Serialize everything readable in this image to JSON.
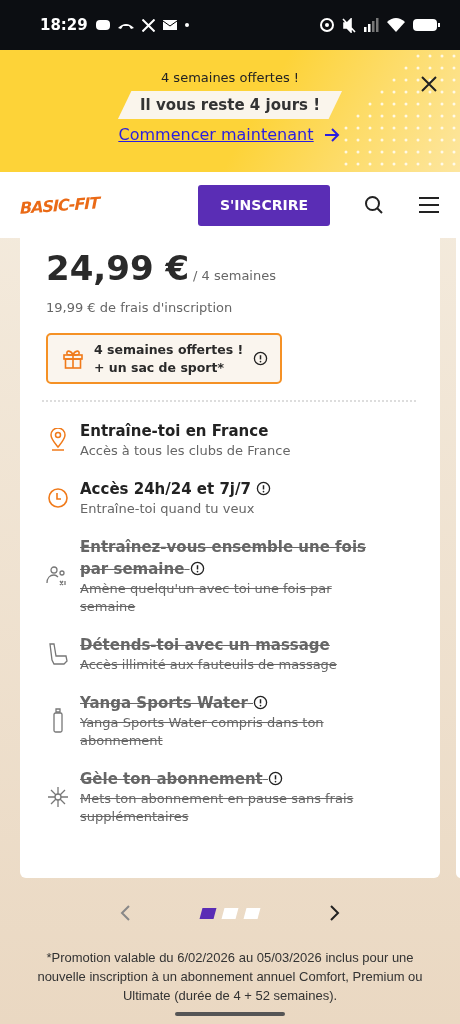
{
  "status_bar": {
    "time": "18:29"
  },
  "banner": {
    "title": "4 semaines offertes !",
    "countdown": "Il vous reste 4 jours !",
    "link": "Commencer maintenant"
  },
  "header": {
    "logo": "BASIC-FIT",
    "signup": "S'INSCRIRE"
  },
  "plan": {
    "price": "24,99 €",
    "period": "/ 4 semaines",
    "fee": "19,99 € de frais d'inscription",
    "offer": {
      "line1": "4 semaines offertes !",
      "line2": "+ un sac de sport*"
    },
    "features": [
      {
        "kind": "location",
        "title": "Entraîne-toi en France",
        "subtitle": "Accès à tous les clubs de France",
        "included": true,
        "info": false
      },
      {
        "kind": "clock",
        "title": "Accès 24h/24 et 7j/7",
        "subtitle": "Entraîne-toi quand tu veux",
        "included": true,
        "info": true
      },
      {
        "kind": "buddy",
        "title": "Entraînez-vous ensemble une fois par semaine",
        "subtitle": "Amène quelqu'un avec toi une fois par semaine",
        "included": false,
        "info": true
      },
      {
        "kind": "massage",
        "title": "Détends-toi avec un massage",
        "subtitle": "Accès illimité aux fauteuils de massage",
        "included": false,
        "info": false
      },
      {
        "kind": "bottle",
        "title": "Yanga Sports Water",
        "subtitle": "Yanga Sports Water compris dans ton abonnement",
        "included": false,
        "info": true
      },
      {
        "kind": "snowflake",
        "title": "Gèle ton abonnement",
        "subtitle": "Mets ton abonnement en pause sans frais supplémentaires",
        "included": false,
        "info": true
      }
    ]
  },
  "carousel": {
    "pages": [
      {
        "selected": true
      },
      {
        "selected": false
      },
      {
        "selected": false
      }
    ]
  },
  "footnote": "*Promotion valable du 6/02/2026 au 05/03/2026 inclus pour une nouvelle inscription à un abonnement annuel Comfort, Premium ou Ultimate (durée de 4 + 52 semaines)."
}
